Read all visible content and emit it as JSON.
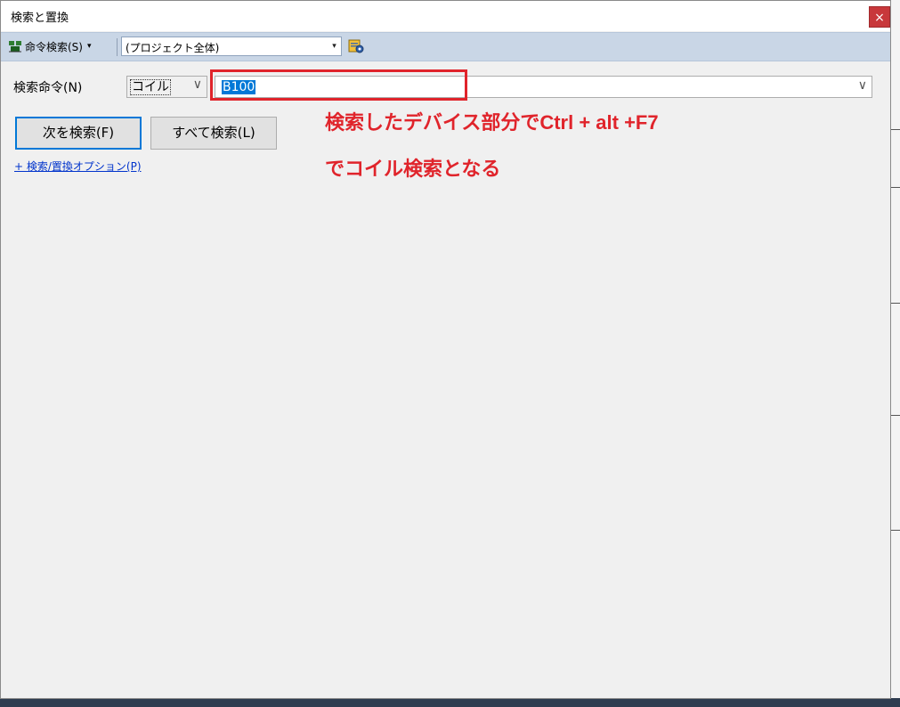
{
  "window": {
    "title": "検索と置換",
    "close_label": "×"
  },
  "toolbar": {
    "mode_label": "命令検索(S)",
    "mode_caret": "▾",
    "scope_value": "(プロジェクト全体)",
    "scope_caret": "▾"
  },
  "form": {
    "search_label": "検索命令(N)",
    "type_value": "コイル",
    "type_caret": "∨",
    "device_value": "B100",
    "device_caret": "∨"
  },
  "buttons": {
    "find_next": "次を検索(F)",
    "find_all": "すべて検索(L)"
  },
  "options_link": "+ 検索/置換オプション(P)",
  "annotation": {
    "line1": "検索したデバイス部分でCtrl + alt +F7",
    "line2": "でコイル検索となる",
    "color": "#e0242b"
  },
  "colors": {
    "accent": "#0078d7",
    "close": "#c8383b",
    "toolbar_bg": "#c9d6e6"
  }
}
